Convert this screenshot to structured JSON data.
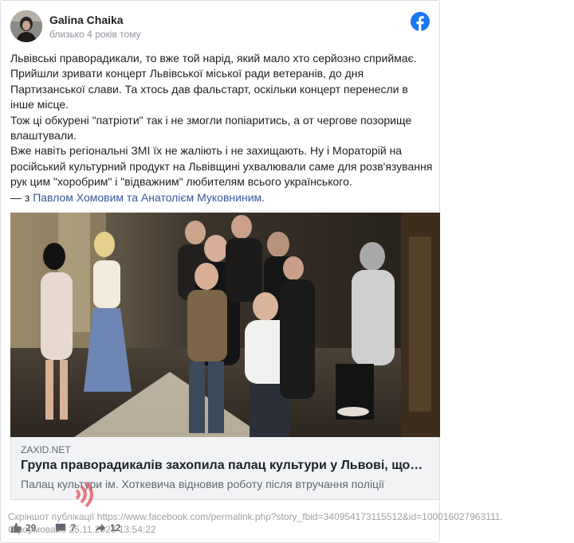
{
  "post": {
    "author": "Galina Chaika",
    "time": "близько 4 років тому",
    "paragraphs": [
      "Львівські праворадикали, то вже той нарід, який мало хто серйозно сприймає. Прийшли зривати концерт Львівської міської ради ветеранів, до дня Партизанської слави. Та хтось дав фальстарт, оскільки концерт перенесли в інше місце.",
      "Тож ці обкурені \"патріоти\" так і не змогли попіаритись, а от чергове позорище влаштували.",
      "Вже навіть регіональні ЗМІ їх не жаліють і не захищають. Ну і Мораторій на російський культурний продукт на Львівщині ухвалювали саме для розв'язування рук цим \"хоробрим\" і \"відважним\" любителям всього українського."
    ],
    "tagged": {
      "prefix": "— з ",
      "person1": "Павлом Хомовим",
      "joiner": " та ",
      "person2": "Анатолієм Муковниним",
      "suffix": "."
    }
  },
  "link_preview": {
    "domain": "ZAXID.NET",
    "title": "Група праворадикалів захопила палац культури у Львові, що…",
    "description": "Палац культури ім. Хоткевича відновив роботу після втручання поліції"
  },
  "reactions": {
    "likes": "29",
    "comments": "7",
    "shares": "12"
  },
  "watermark": {
    "line1": "Скріншот публікації https://www.facebook.com/permalink.php?story_fbid=340954173115512&id=100016027963111.",
    "line2": "Сформовано 25.11.2023 13:54:22"
  },
  "colors": {
    "facebook_blue": "#1877f2",
    "link_blue": "#385898",
    "link_box_bg": "#f2f3f5",
    "watermark_logo": "#e0525c"
  },
  "icons": {
    "brand": "facebook-logo-icon",
    "like": "thumbs-up-icon",
    "comment": "comment-bubble-icon",
    "share": "share-arrow-icon"
  }
}
